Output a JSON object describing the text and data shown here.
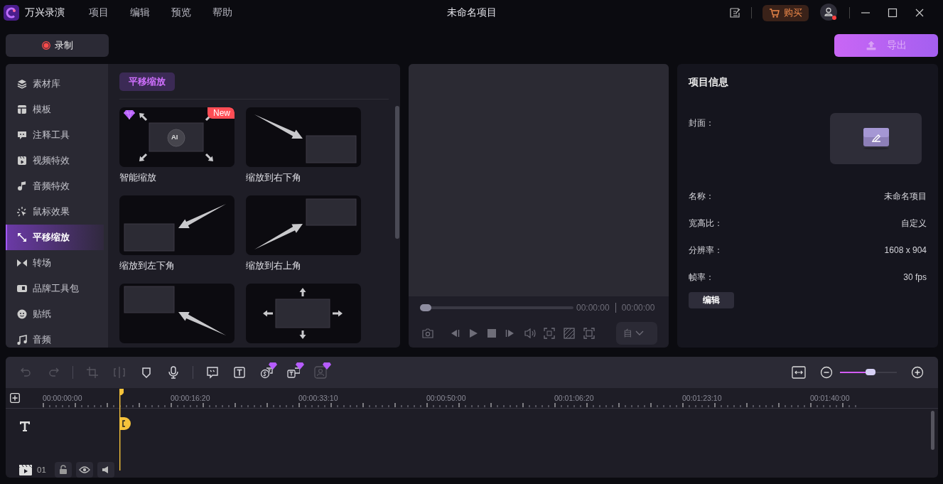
{
  "window": {
    "app_name": "万兴录演",
    "menu": [
      "项目",
      "编辑",
      "预览",
      "帮助"
    ],
    "title": "未命名项目",
    "buy_button": "购买",
    "notification": true
  },
  "record_button": "录制",
  "export_button": "导出",
  "sidebar": {
    "items": [
      {
        "label": "素材库",
        "selected": false
      },
      {
        "label": "模板",
        "selected": false
      },
      {
        "label": "注释工具",
        "selected": false
      },
      {
        "label": "视频特效",
        "selected": false
      },
      {
        "label": "音频特效",
        "selected": false
      },
      {
        "label": "鼠标效果",
        "selected": false
      },
      {
        "label": "平移缩放",
        "selected": true
      },
      {
        "label": "转场",
        "selected": false
      },
      {
        "label": "品牌工具包",
        "selected": false
      },
      {
        "label": "贴纸",
        "selected": false
      },
      {
        "label": "音频",
        "selected": false
      }
    ]
  },
  "library": {
    "section": "平移缩放",
    "presets": [
      {
        "kind": "ai",
        "label": "智能缩放",
        "badge": "New",
        "premium": true,
        "overlay": "AI"
      },
      {
        "kind": "bottom-right",
        "label": "缩放到右下角",
        "premium": false
      },
      {
        "kind": "bottom-left",
        "label": "缩放到左下角",
        "premium": false
      },
      {
        "kind": "top-right",
        "label": "缩放到右上角",
        "premium": false
      },
      {
        "kind": "top-left",
        "premium": false
      },
      {
        "kind": "center",
        "premium": false
      }
    ]
  },
  "preview": {
    "level": 0,
    "current_time": "00:00:00",
    "total_time": "00:00:00",
    "ratio": "自"
  },
  "project_info": {
    "title": "项目信息",
    "cover_label": "封面：",
    "fields": [
      {
        "label": "名称：",
        "value": "未命名项目"
      },
      {
        "label": "宽高比：",
        "value": "自定义"
      },
      {
        "label": "分辨率：",
        "value": "1608 x 904"
      },
      {
        "label": "帧率：",
        "value": "30 fps"
      }
    ],
    "edit_button": "编辑"
  },
  "timeline": {
    "tool_groups": [
      [
        {
          "kind": "undo",
          "disabled": true,
          "premium": false
        },
        {
          "kind": "redo",
          "disabled": true,
          "premium": false
        }
      ],
      [
        {
          "kind": "crop",
          "disabled": true,
          "premium": false
        },
        {
          "kind": "split",
          "disabled": true,
          "premium": false
        },
        {
          "kind": "marker",
          "disabled": false,
          "premium": false
        },
        {
          "kind": "mic",
          "disabled": false,
          "premium": false
        }
      ],
      [
        {
          "kind": "caption",
          "disabled": false,
          "premium": false
        },
        {
          "kind": "text",
          "disabled": false,
          "premium": false
        },
        {
          "kind": "subtitle",
          "disabled": false,
          "premium": true
        },
        {
          "kind": "textbox",
          "disabled": false,
          "premium": true
        },
        {
          "kind": "avatar",
          "disabled": true,
          "premium": true
        }
      ]
    ],
    "zoom": {
      "level": 0.54
    },
    "ruler": [
      "00:00:00:00",
      "00:00:16:20",
      "00:00:33:10",
      "00:00:50:00",
      "00:01:06:20",
      "00:01:23:10",
      "00:01:40:00"
    ],
    "track_number": "01"
  }
}
